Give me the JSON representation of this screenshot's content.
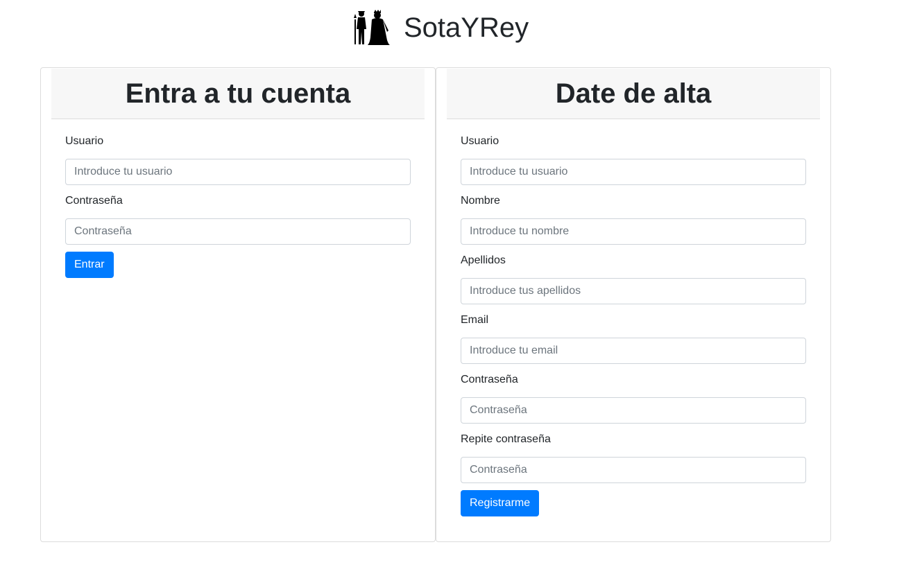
{
  "header": {
    "brand": "SotaYRey",
    "logo_icon": "jack-and-king-silhouette-icon"
  },
  "login": {
    "title": "Entra a tu cuenta",
    "fields": [
      {
        "label": "Usuario",
        "placeholder": "Introduce tu usuario",
        "value": ""
      },
      {
        "label": "Contraseña",
        "placeholder": "Contraseña",
        "value": ""
      }
    ],
    "submit_label": "Entrar"
  },
  "register": {
    "title": "Date de alta",
    "fields": [
      {
        "label": "Usuario",
        "placeholder": "Introduce tu usuario",
        "value": ""
      },
      {
        "label": "Nombre",
        "placeholder": "Introduce tu nombre",
        "value": ""
      },
      {
        "label": "Apellidos",
        "placeholder": "Introduce tus apellidos",
        "value": ""
      },
      {
        "label": "Email",
        "placeholder": "Introduce tu email",
        "value": ""
      },
      {
        "label": "Contraseña",
        "placeholder": "Contraseña",
        "value": ""
      },
      {
        "label": "Repite contraseña",
        "placeholder": "Contraseña",
        "value": ""
      }
    ],
    "submit_label": "Registrarme"
  },
  "colors": {
    "primary": "#007bff",
    "card_header_bg": "#f7f7f7",
    "border": "#dcdcdc",
    "text": "#212529"
  }
}
